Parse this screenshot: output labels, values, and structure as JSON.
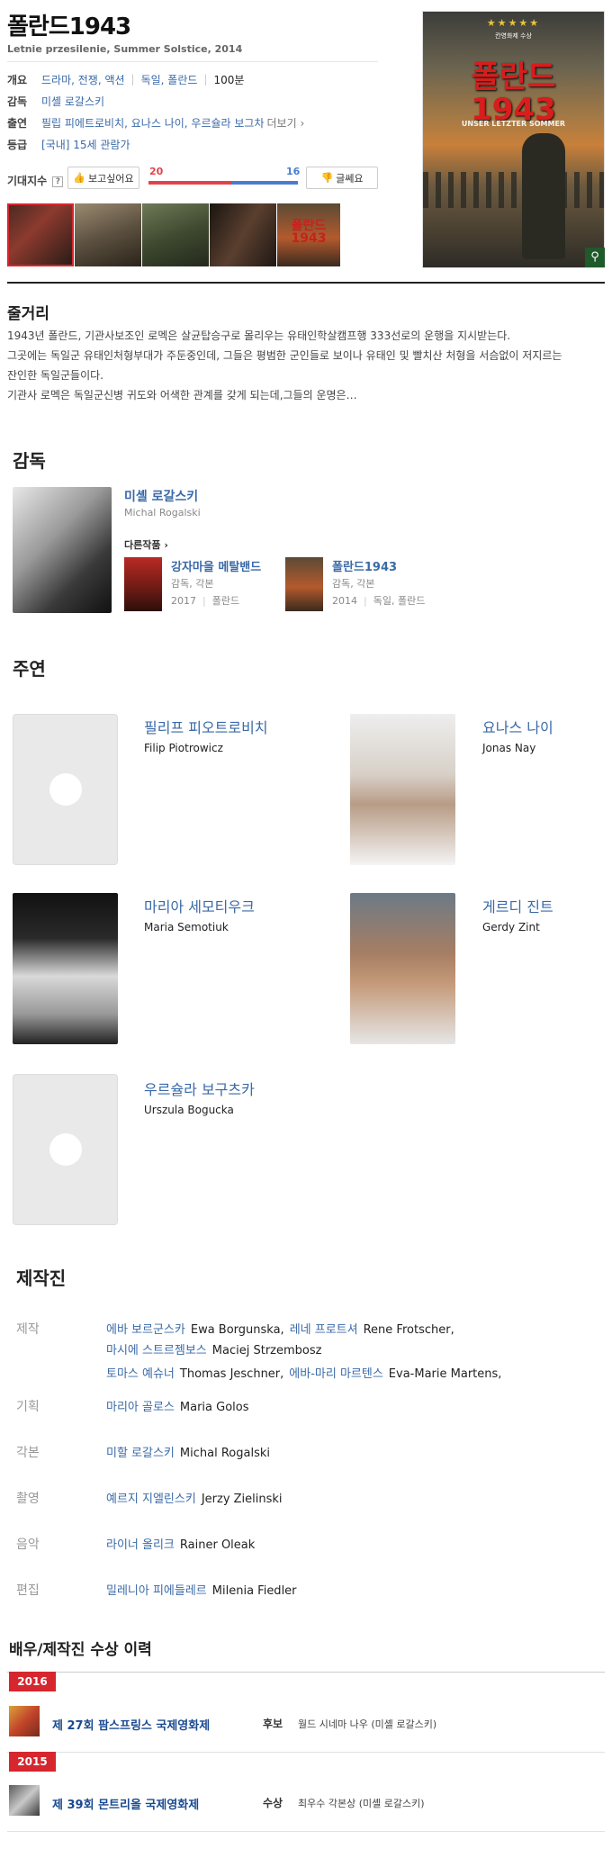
{
  "movie": {
    "title": "폴란드1943",
    "subtitle": "Letnie przesilenie, Summer Solstice, 2014",
    "info": {
      "overview_label": "개요",
      "genres": "드라마, 전쟁, 액션",
      "countries": "독일, 폴란드",
      "runtime": "100분",
      "director_label": "감독",
      "director": "미셸 로갈스키",
      "cast_label": "출연",
      "cast": "필립 피에트로비치, 요나스 나이, 우르슐라 보그차",
      "more": "더보기",
      "rating_label": "등급",
      "rating": "[국내] 15세 관람가"
    },
    "expect": {
      "label": "기대지수",
      "help": "?",
      "want": "보고싶어요",
      "want_count": "20",
      "meh": "글쎄요",
      "meh_count": "16",
      "want_share": 0.556
    },
    "poster": {
      "stars": "★★★★★",
      "award_text": "칸영화제 수상",
      "title_line1": "폴란드",
      "title_line2": "1943",
      "subtitle": "UNSER LETZTER SOMMER"
    }
  },
  "plot": {
    "heading": "줄거리",
    "lines": [
      "1943년 폴란드, 기관사보조인 로멕은 살균탑승구로 몰리우는 유태인학살캠프행 333선로의 운행을 지시받는다.",
      "그곳에는 독일군 유태인처형부대가 주둔중인데, 그들은 평범한 군인들로 보이나 유태인 및 빨치산 처형을 서슴없이 저지르는",
      "잔인한 독일군들이다.",
      "기관사 로멕은 독일군신병 귀도와 어색한 관계를 갖게 되는데,그들의 운명은…"
    ]
  },
  "director": {
    "heading": "감독",
    "name_ko": "미셸 로갈스키",
    "name_en": "Michal Rogalski",
    "works_label": "다른작품",
    "works": [
      {
        "title": "강자마을 메탈밴드",
        "role": "감독, 각본",
        "year": "2017",
        "country": "폴란드"
      },
      {
        "title": "폴란드1943",
        "role": "감독, 각본",
        "year": "2014",
        "country": "독일, 폴란드"
      }
    ]
  },
  "cast": {
    "heading": "주연",
    "members": [
      {
        "ko": "필리프 피오트로비치",
        "en": "Filip Piotrowicz"
      },
      {
        "ko": "요나스 나이",
        "en": "Jonas Nay"
      },
      {
        "ko": "마리아 세모티우크",
        "en": "Maria Semotiuk"
      },
      {
        "ko": "게르디 진트",
        "en": "Gerdy Zint"
      },
      {
        "ko": "우르슐라 보구츠카",
        "en": "Urszula Bogucka"
      }
    ]
  },
  "crew": {
    "heading": "제작진",
    "groups": [
      {
        "label": "제작",
        "lines": [
          [
            {
              "ko": "에바 보르군스카",
              "en": "Ewa Borgunska,"
            },
            {
              "ko": "레네 프로트셔",
              "en": "Rene Frotscher,"
            }
          ],
          [
            {
              "ko": "마시에 스트르젬보스",
              "en": "Maciej Strzembosz"
            }
          ],
          [
            {
              "ko": "토마스 예슈너",
              "en": "Thomas Jeschner,"
            },
            {
              "ko": "에바-마리 마르텐스",
              "en": "Eva-Marie Martens,"
            }
          ]
        ]
      },
      {
        "label": "기획",
        "lines": [
          [
            {
              "ko": "마리아 골로스",
              "en": "Maria Golos"
            }
          ]
        ]
      },
      {
        "label": "각본",
        "lines": [
          [
            {
              "ko": "미할 로갈스키",
              "en": "Michal Rogalski"
            }
          ]
        ]
      },
      {
        "label": "촬영",
        "lines": [
          [
            {
              "ko": "예르지 지엘린스키",
              "en": "Jerzy Zielinski"
            }
          ]
        ]
      },
      {
        "label": "음악",
        "lines": [
          [
            {
              "ko": "라이너 올리크",
              "en": "Rainer Oleak"
            }
          ]
        ]
      },
      {
        "label": "편집",
        "lines": [
          [
            {
              "ko": "밀레니아 피에들레르",
              "en": "Milenia Fiedler"
            }
          ]
        ]
      }
    ]
  },
  "awards": {
    "heading": "배우/제작진 수상 이력",
    "items": [
      {
        "year": "2016",
        "festival": "제 27회 팜스프링스 국제영화제",
        "status": "후보",
        "detail": "월드 시네마 나우 (미셸 로갈스키)"
      },
      {
        "year": "2015",
        "festival": "제 39회 몬트리올 국제영화제",
        "status": "수상",
        "detail": "최우수 각본상 (미셸 로갈스키)"
      }
    ]
  },
  "colors": {
    "link": "#3a6aa8",
    "want_bar": "#e0434b",
    "meh_bar": "#4a7ccf",
    "award_badge": "#d6262e",
    "award_link": "#1a4a90"
  }
}
